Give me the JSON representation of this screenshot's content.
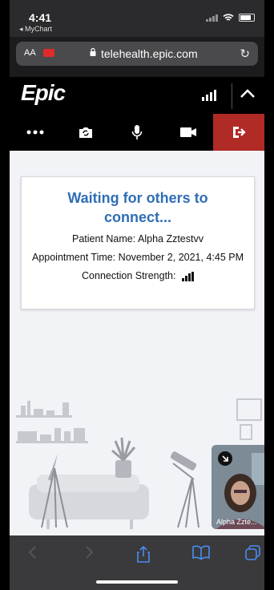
{
  "status_bar": {
    "time": "4:41",
    "back_app": "◂ MyChart"
  },
  "browser": {
    "text_size": "AA",
    "url": "telehealth.epic.com"
  },
  "header": {
    "logo": "Epic"
  },
  "card": {
    "heading": "Waiting for others to connect...",
    "patient_name": "Patient Name: Alpha Zztestvv",
    "appointment_time": "Appointment Time: November 2, 2021, 4:45 PM",
    "connection_strength": "Connection Strength:"
  },
  "pip": {
    "name": "Alpha Zzte..."
  },
  "colors": {
    "brand_blue": "#2f6eb5",
    "end_call_red": "#b02a26"
  }
}
